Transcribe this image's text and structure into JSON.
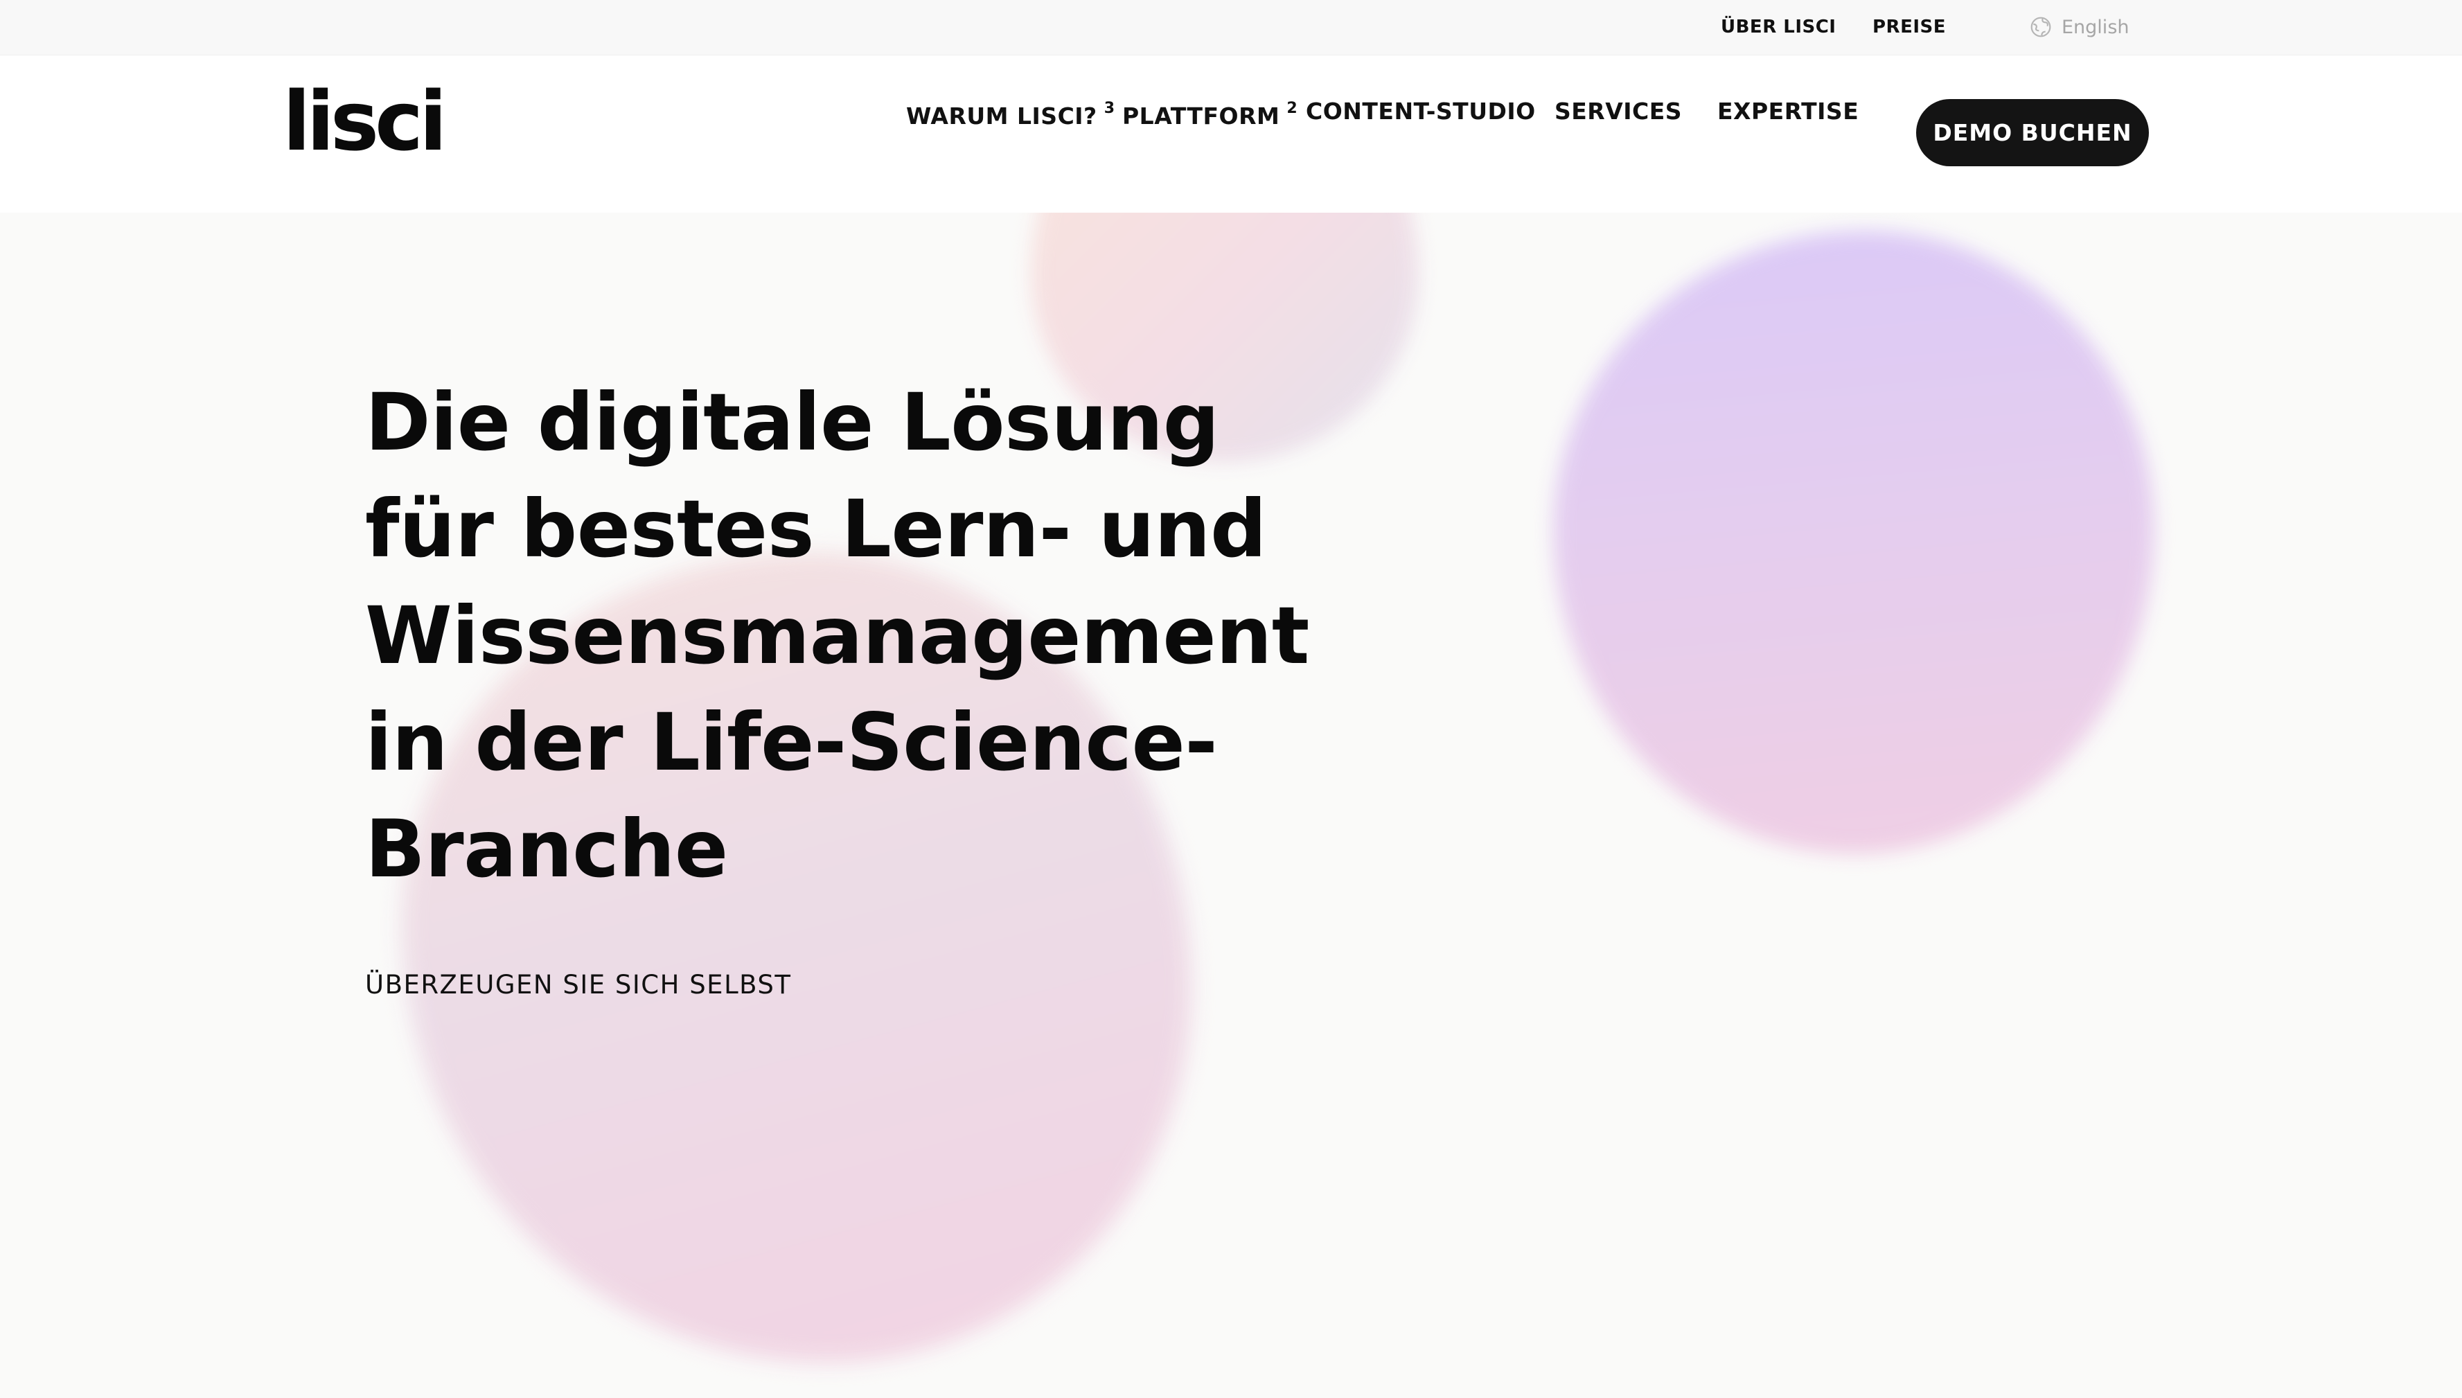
{
  "topbar": {
    "about": "ÜBER LISCI",
    "pricing": "PREISE",
    "language": "English"
  },
  "header": {
    "logo": "lisci",
    "nav": [
      {
        "label": "WARUM LISCI?",
        "badge": "3"
      },
      {
        "label": "PLATTFORM",
        "badge": "2"
      },
      {
        "label": "CONTENT-STUDIO"
      },
      {
        "label": "SERVICES"
      },
      {
        "label": "EXPERTISE"
      }
    ],
    "cta": "DEMO BUCHEN"
  },
  "hero": {
    "headline": "Die digitale Lösung für bestes Lern- und Wissensmanagement in der Life-Science-Branche",
    "subline": "ÜBERZEUGEN SIE SICH SELBST"
  },
  "colors": {
    "button_bg": "#141414",
    "blob_purple": "#dbc8f6",
    "blob_pink": "#f2d2e2",
    "page_bg": "#fafaf9"
  },
  "icons": {
    "language": "globe-icon"
  }
}
